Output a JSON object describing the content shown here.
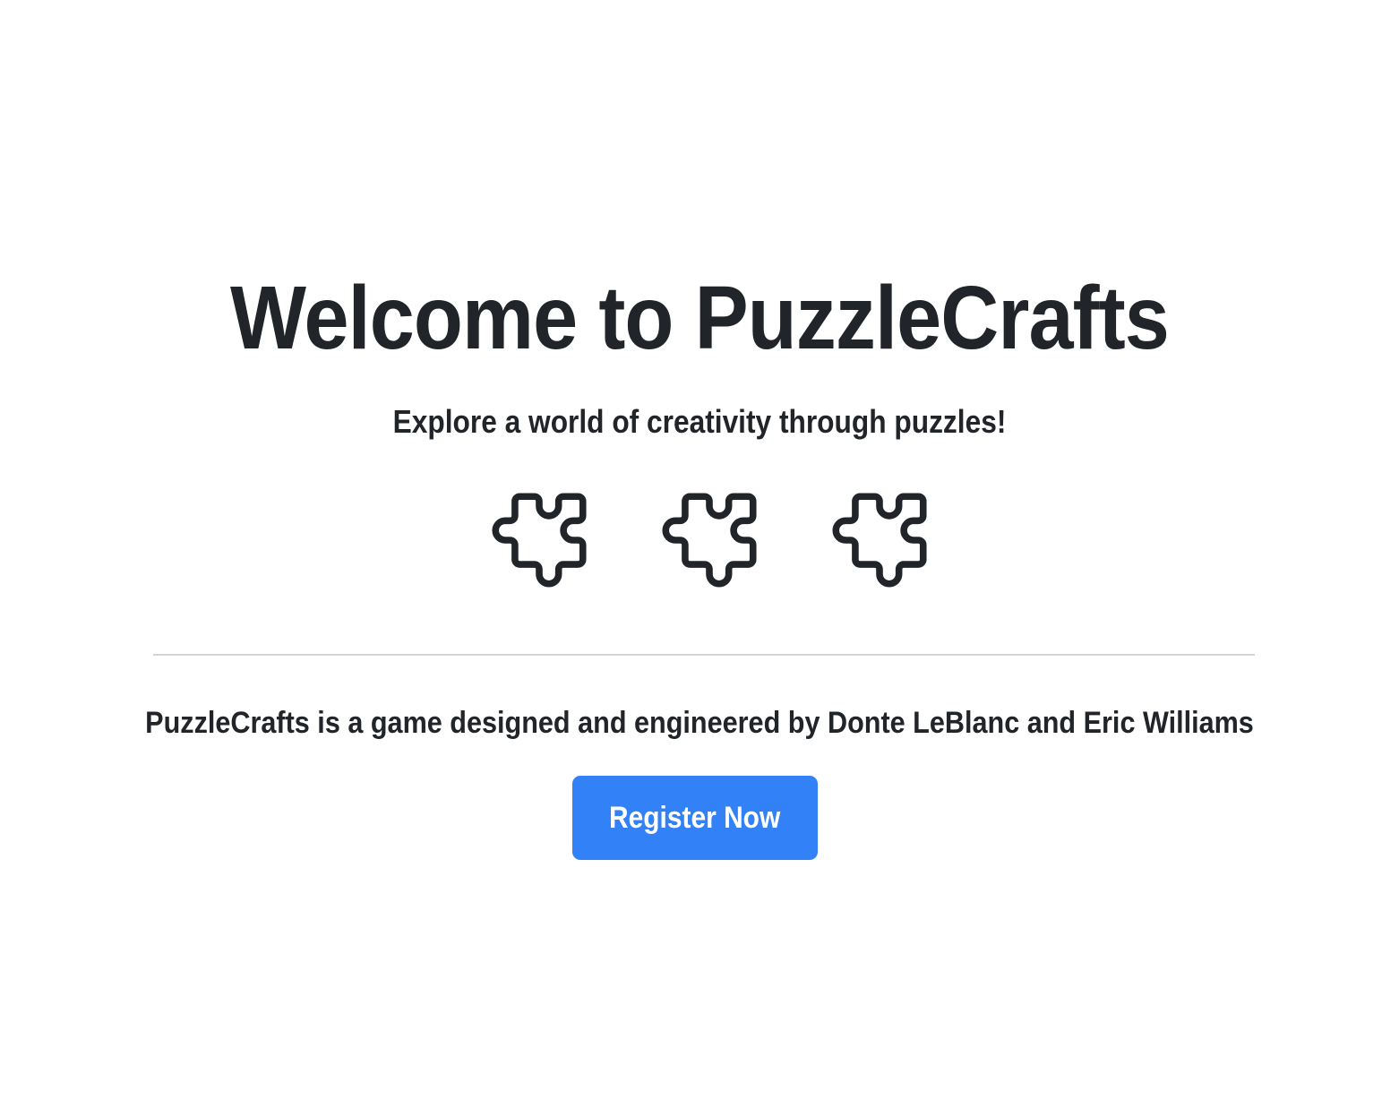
{
  "hero": {
    "title": "Welcome to PuzzleCrafts",
    "subtitle": "Explore a world of creativity through puzzles!"
  },
  "icons": [
    "puzzle-piece-icon",
    "puzzle-piece-icon",
    "puzzle-piece-icon"
  ],
  "about": {
    "credits": "PuzzleCrafts is a game designed and engineered by Donte LeBlanc and Eric Williams"
  },
  "cta": {
    "register_label": "Register Now"
  },
  "colors": {
    "text": "#212529",
    "accent": "#3381f7",
    "divider": "#d4d4d6",
    "background": "#ffffff"
  }
}
